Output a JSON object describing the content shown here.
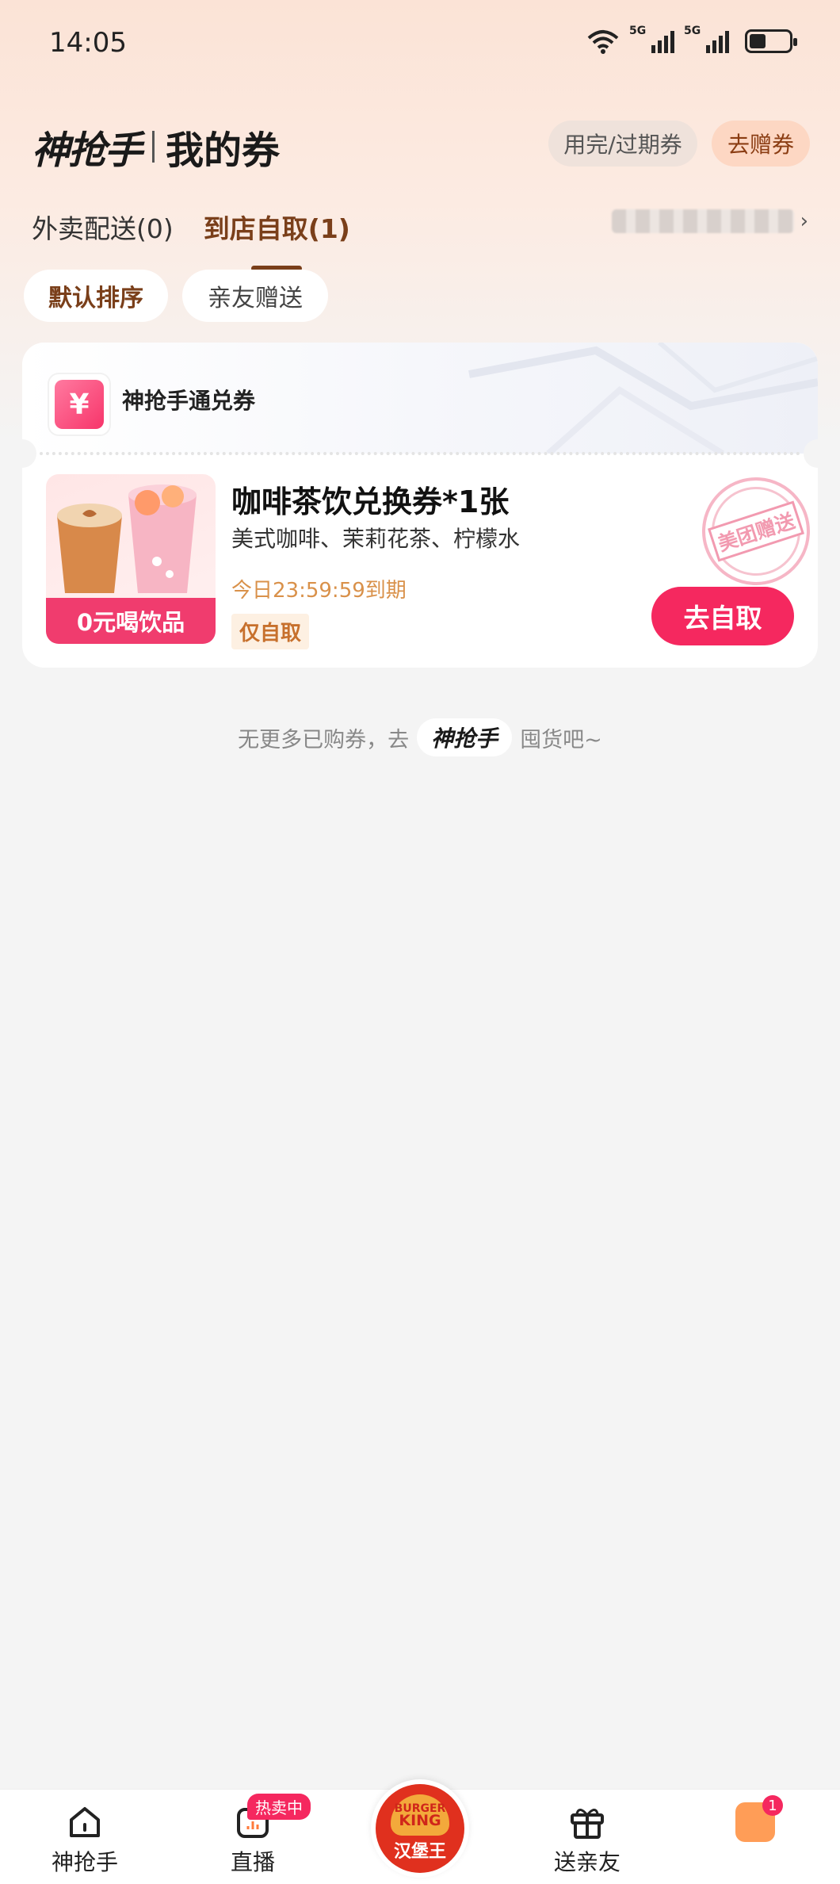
{
  "status_bar": {
    "time": "14:05",
    "sim1": "5G",
    "sim2": "5G"
  },
  "header": {
    "brand": "神抢手",
    "title": "我的券",
    "expired_button": "用完/过期券",
    "gift_button": "去赠券"
  },
  "tabs": [
    {
      "label": "外卖配送(0)",
      "active": false
    },
    {
      "label": "到店自取(1)",
      "active": true
    }
  ],
  "filters": {
    "default_sort": "默认排序",
    "friend_gift": "亲友赠送"
  },
  "coupon": {
    "category_icon": "¥",
    "category": "神抢手通兑券",
    "image_label": "0元喝饮品",
    "title": "咖啡茶饮兑换券*1张",
    "description": "美式咖啡、茉莉花茶、柠檬水",
    "expiry": "今日23:59:59到期",
    "tag": "仅自取",
    "stamp": "美团赠送",
    "action": "去自取"
  },
  "footer_note": {
    "prefix": "无更多已购券，去",
    "logo": "神抢手",
    "suffix": "囤货吧~"
  },
  "bottom_nav": {
    "home": "神抢手",
    "live": "直播",
    "live_badge": "热卖中",
    "center_brand_top": "BURGER",
    "center_brand_bottom": "KING",
    "center_label": "汉堡王",
    "friend": "送亲友",
    "mine_badge": "1"
  },
  "colors": {
    "accent": "#f5285f",
    "brown": "#7a3f1a",
    "orange": "#d9914a"
  }
}
